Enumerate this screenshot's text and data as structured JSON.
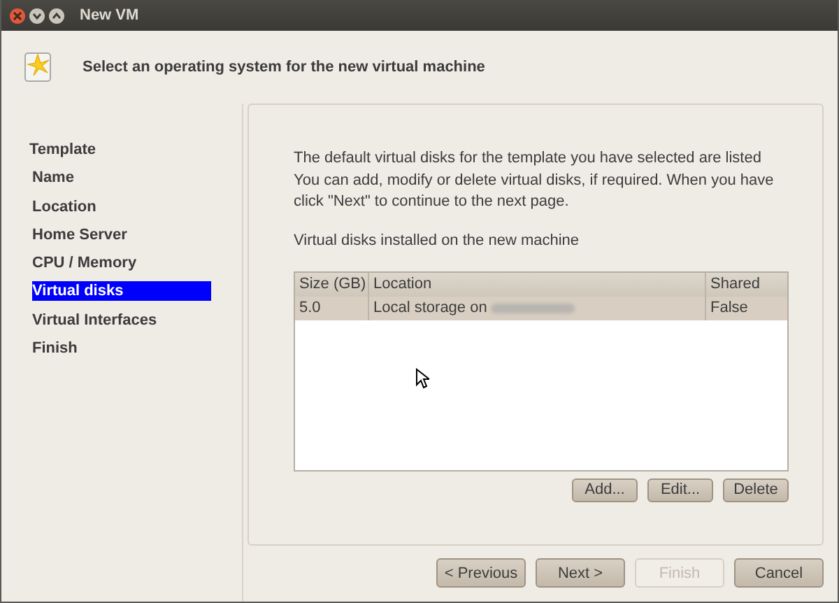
{
  "window": {
    "title": "New VM"
  },
  "header": {
    "title": "Select an operating system for the new virtual machine"
  },
  "sidebar": {
    "items": [
      {
        "label": "Template",
        "selected": false
      },
      {
        "label": "Name",
        "selected": false
      },
      {
        "label": "Location",
        "selected": false
      },
      {
        "label": "Home Server",
        "selected": false
      },
      {
        "label": "CPU / Memory",
        "selected": false
      },
      {
        "label": "Virtual disks",
        "selected": true
      },
      {
        "label": "Virtual Interfaces",
        "selected": false
      },
      {
        "label": "Finish",
        "selected": false
      }
    ]
  },
  "content": {
    "description": "The default virtual disks for the template you have selected are listed\nYou can add, modify or delete virtual disks, if required. When you have\nclick \"Next\" to continue to the next page.",
    "table_caption": "Virtual disks installed on the new machine",
    "table": {
      "columns": [
        "Size (GB)",
        "Location",
        "Shared"
      ],
      "rows": [
        {
          "cells": [
            "5.0",
            "Local storage on",
            "False"
          ],
          "selected": true
        }
      ]
    },
    "buttons": [
      {
        "label": "Add...",
        "disabled": false
      },
      {
        "label": "Edit...",
        "disabled": false
      },
      {
        "label": "Delete",
        "disabled": false
      }
    ]
  },
  "footer": {
    "buttons": [
      {
        "label": "< Previous",
        "disabled": false
      },
      {
        "label": "Next >",
        "disabled": false
      },
      {
        "label": "Finish",
        "disabled": true
      },
      {
        "label": "Cancel",
        "disabled": false
      }
    ]
  }
}
